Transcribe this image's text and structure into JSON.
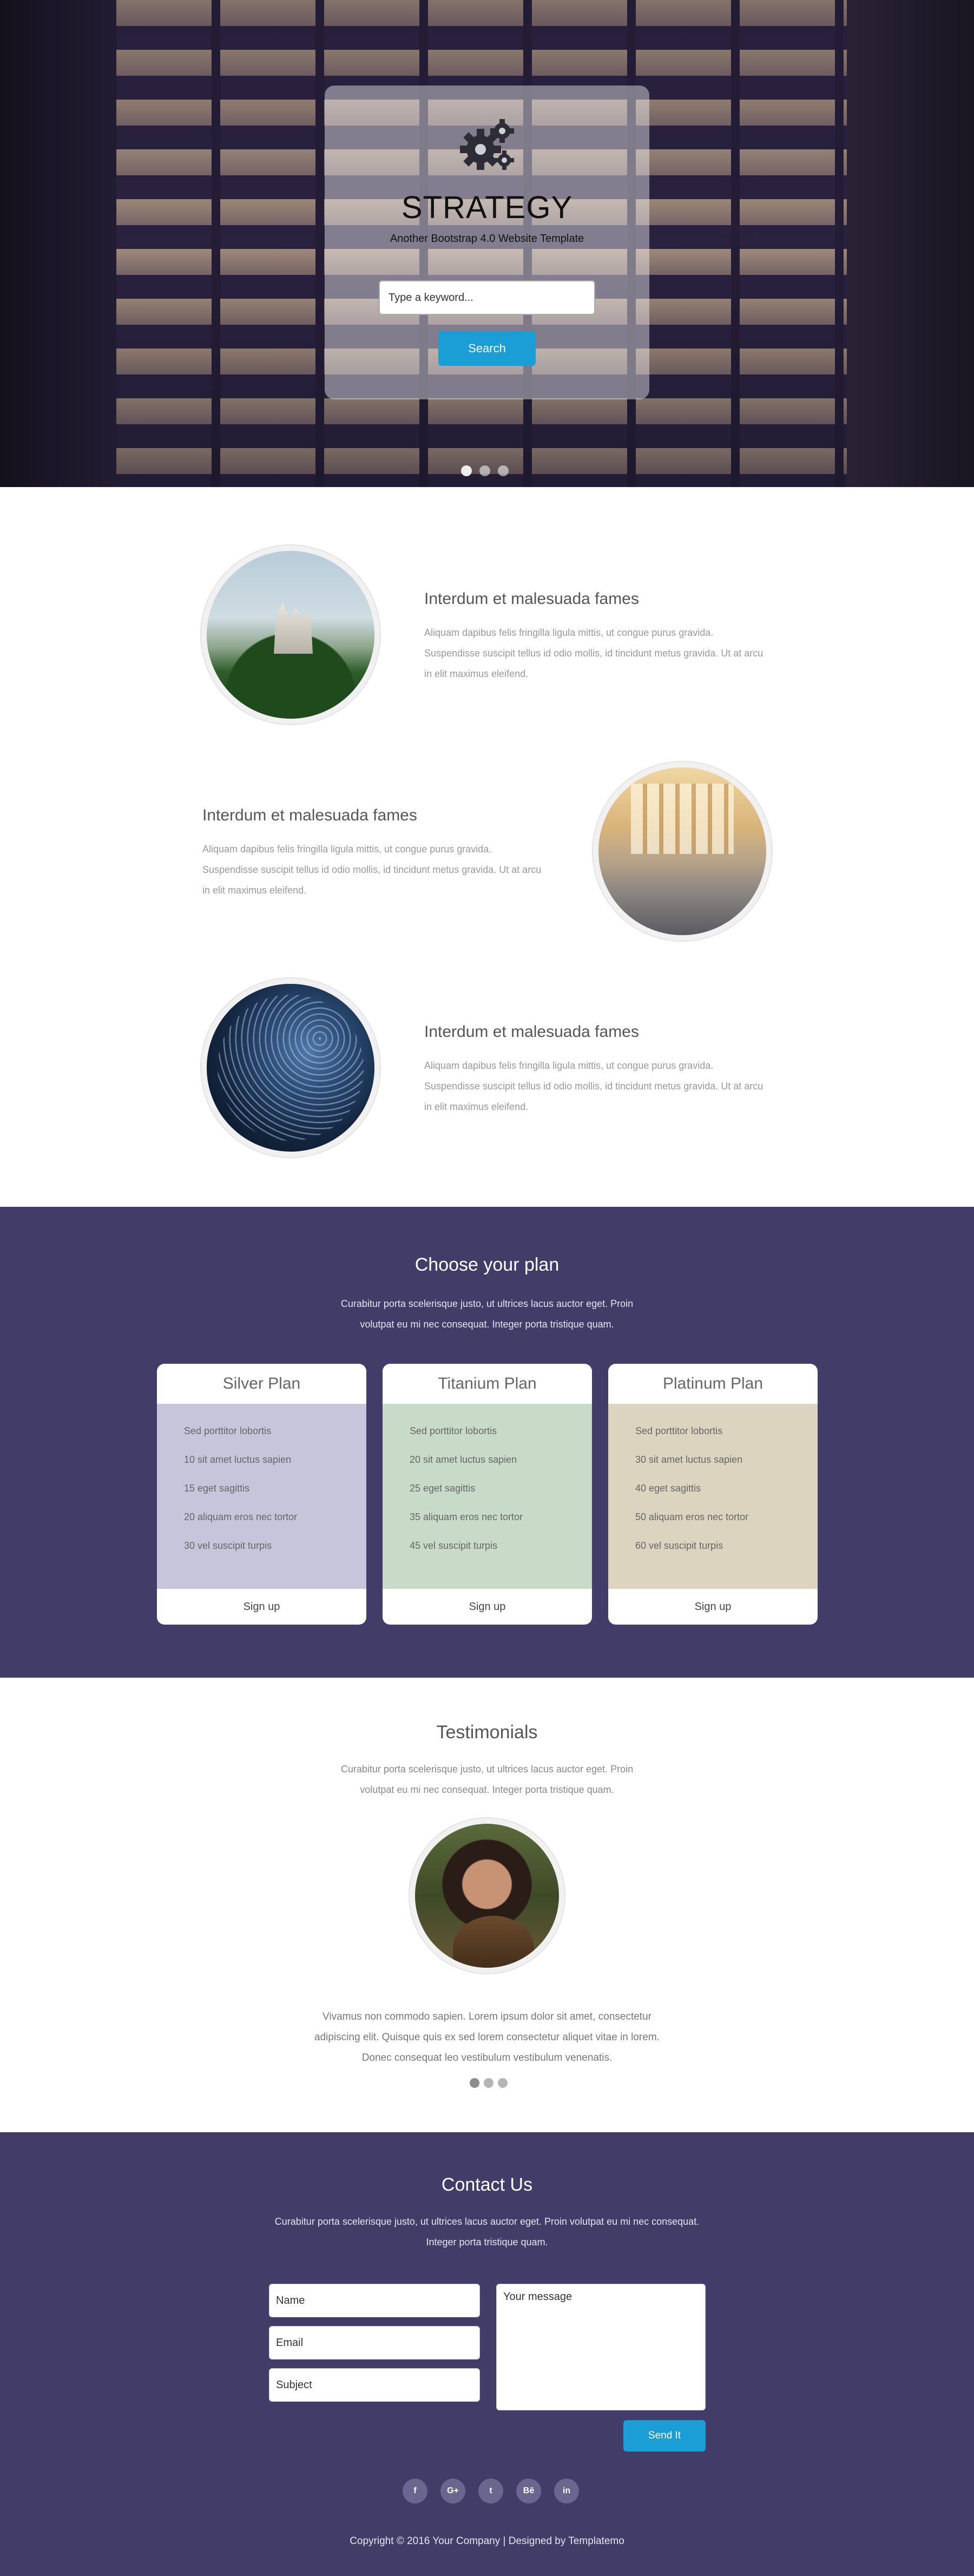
{
  "hero": {
    "title": "STRATEGY",
    "subtitle": "Another Bootstrap 4.0 Website Template",
    "search_placeholder": "Type a keyword...",
    "search_button": "Search",
    "carousel_dots": 3,
    "active_dot": 0
  },
  "features": [
    {
      "title": "Interdum et malesuada fames",
      "text": "Aliquam dapibus felis fringilla ligula mittis, ut congue purus gravida. Suspendisse suscipit tellus id odio mollis, id tincidunt metus gravida. Ut at arcu in elit maximus eleifend.",
      "image": "castle-photo"
    },
    {
      "title": "Interdum et malesuada fames",
      "text": "Aliquam dapibus felis fringilla ligula mittis, ut congue purus gravida. Suspendisse suscipit tellus id odio mollis, id tincidunt metus gravida. Ut at arcu in elit maximus eleifend.",
      "image": "train-station-photo"
    },
    {
      "title": "Interdum et malesuada fames",
      "text": "Aliquam dapibus felis fringilla ligula mittis, ut congue purus gravida. Suspendisse suscipit tellus id odio mollis, id tincidunt metus gravida. Ut at arcu in elit maximus eleifend.",
      "image": "star-trails-photo"
    }
  ],
  "plans": {
    "title": "Choose your plan",
    "text": "Curabitur porta scelerisque justo, ut ultrices lacus auctor eget. Proin volutpat eu mi nec consequat. Integer porta tristique quam.",
    "items": [
      {
        "name": "Silver Plan",
        "color": "#c6c5dc",
        "features": [
          "Sed porttitor lobortis",
          "10 sit amet luctus sapien",
          "15 eget sagittis",
          "20 aliquam eros nec tortor",
          "30 vel suscipit turpis"
        ],
        "cta": "Sign up"
      },
      {
        "name": "Titanium Plan",
        "color": "#c8dbc9",
        "features": [
          "Sed porttitor lobortis",
          "20 sit amet luctus sapien",
          "25 eget sagittis",
          "35 aliquam eros nec tortor",
          "45 vel suscipit turpis"
        ],
        "cta": "Sign up"
      },
      {
        "name": "Platinum Plan",
        "color": "#ddd4c0",
        "features": [
          "Sed porttitor lobortis",
          "30 sit amet luctus sapien",
          "40 eget sagittis",
          "50 aliquam eros nec tortor",
          "60 vel suscipit turpis"
        ],
        "cta": "Sign up"
      }
    ]
  },
  "testimonials": {
    "title": "Testimonials",
    "text": "Curabitur porta scelerisque justo, ut ultrices lacus auctor eget. Proin volutpat eu mi nec consequat. Integer porta tristique quam.",
    "quote": "Vivamus non commodo sapien. Lorem ipsum dolor sit amet, consectetur adipiscing elit. Quisque quis ex sed lorem consectetur aliquet vitae in lorem. Donec consequat leo vestibulum vestibulum venenatis.",
    "dots": 3,
    "active_dot": 0
  },
  "contact": {
    "title": "Contact Us",
    "text": "Curabitur porta scelerisque justo, ut ultrices lacus auctor eget. Proin volutpat eu mi nec consequat. Integer porta tristique quam.",
    "name_placeholder": "Name",
    "email_placeholder": "Email",
    "subject_placeholder": "Subject",
    "message_placeholder": "Your message",
    "send_button": "Send It",
    "socials": [
      {
        "icon": "facebook-icon",
        "glyph": "f"
      },
      {
        "icon": "google-plus-icon",
        "glyph": "G+"
      },
      {
        "icon": "twitter-icon",
        "glyph": "t"
      },
      {
        "icon": "behance-icon",
        "glyph": "Bē"
      },
      {
        "icon": "linkedin-icon",
        "glyph": "in"
      }
    ],
    "copyright": "Copyright © 2016 Your Company | Designed by Templatemo"
  },
  "colors": {
    "accent": "#1b9ed6",
    "section_dark": "#413c68"
  }
}
